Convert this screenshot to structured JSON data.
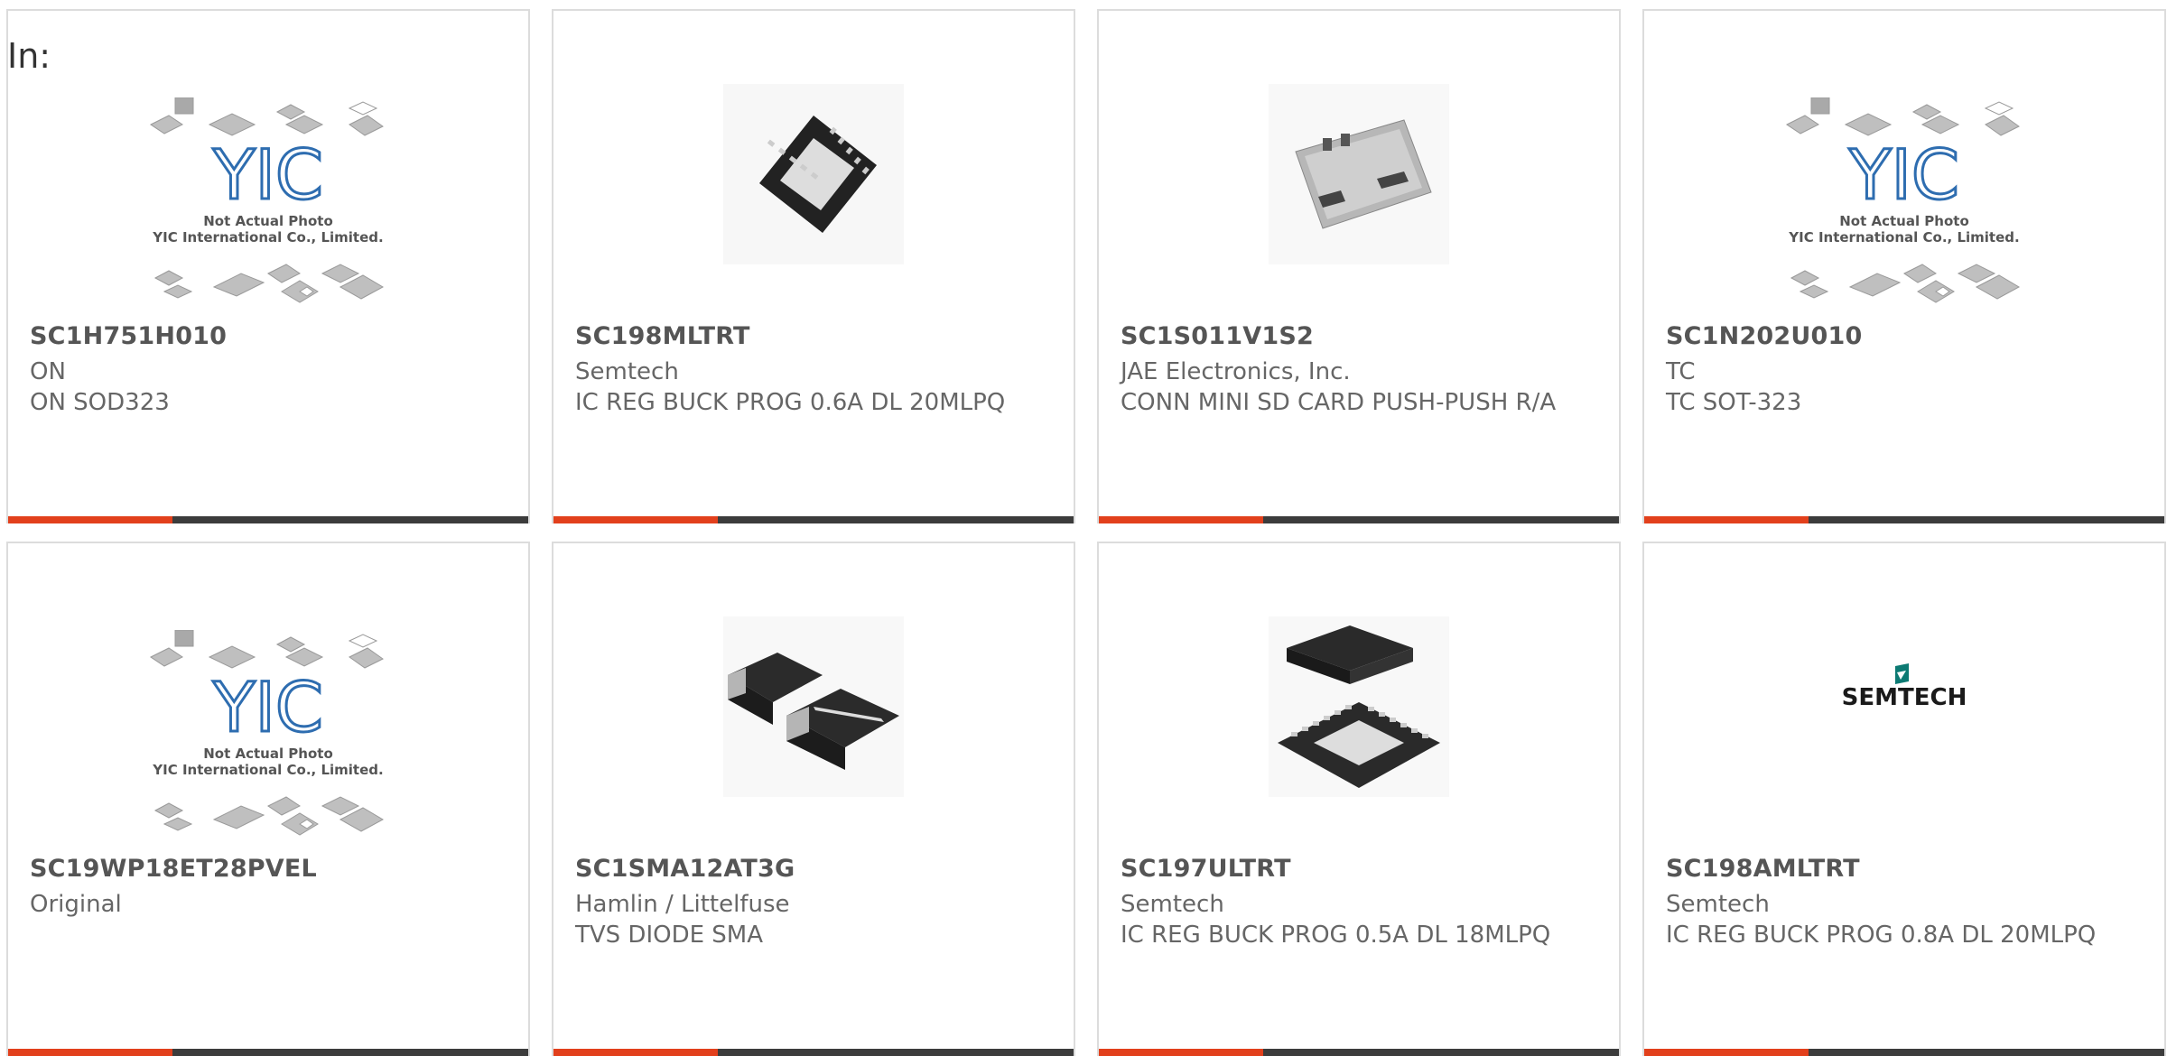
{
  "header": {
    "in_label": "In:"
  },
  "brand_colors": {
    "accent": "#e2401c",
    "bar": "#3c3c3c",
    "border": "#dcdcdc"
  },
  "placeholder": {
    "line1": "Not Actual Photo",
    "line2": "YIC International Co., Limited.",
    "logo_text": "YIC"
  },
  "products": [
    {
      "part": "SC1H751H010",
      "mfr": "ON",
      "desc": "ON SOD323",
      "image": "placeholder-photo"
    },
    {
      "part": "SC198MLTRT",
      "mfr": "Semtech",
      "desc": "IC REG BUCK PROG 0.6A DL 20MLPQ",
      "image": "qfn-chip-photo"
    },
    {
      "part": "SC1S011V1S2",
      "mfr": "JAE Electronics, Inc.",
      "desc": "CONN MINI SD CARD PUSH-PUSH R/A",
      "image": "sd-connector-photo"
    },
    {
      "part": "SC1N202U010",
      "mfr": "TC",
      "desc": "TC SOT-323",
      "image": "placeholder-photo"
    },
    {
      "part": "SC19WP18ET28PVEL",
      "mfr": "Original",
      "desc": "",
      "image": "placeholder-photo"
    },
    {
      "part": "SC1SMA12AT3G",
      "mfr": "Hamlin / Littelfuse",
      "desc": "TVS DIODE SMA",
      "image": "sma-diode-photo"
    },
    {
      "part": "SC197ULTRT",
      "mfr": "Semtech",
      "desc": "IC REG BUCK PROG 0.5A DL 18MLPQ",
      "image": "mlpq-chip-photo"
    },
    {
      "part": "SC198AMLTRT",
      "mfr": "Semtech",
      "desc": "IC REG BUCK PROG 0.8A DL 20MLPQ",
      "image": "semtech-logo",
      "logo_text": "SEMTECH"
    }
  ]
}
